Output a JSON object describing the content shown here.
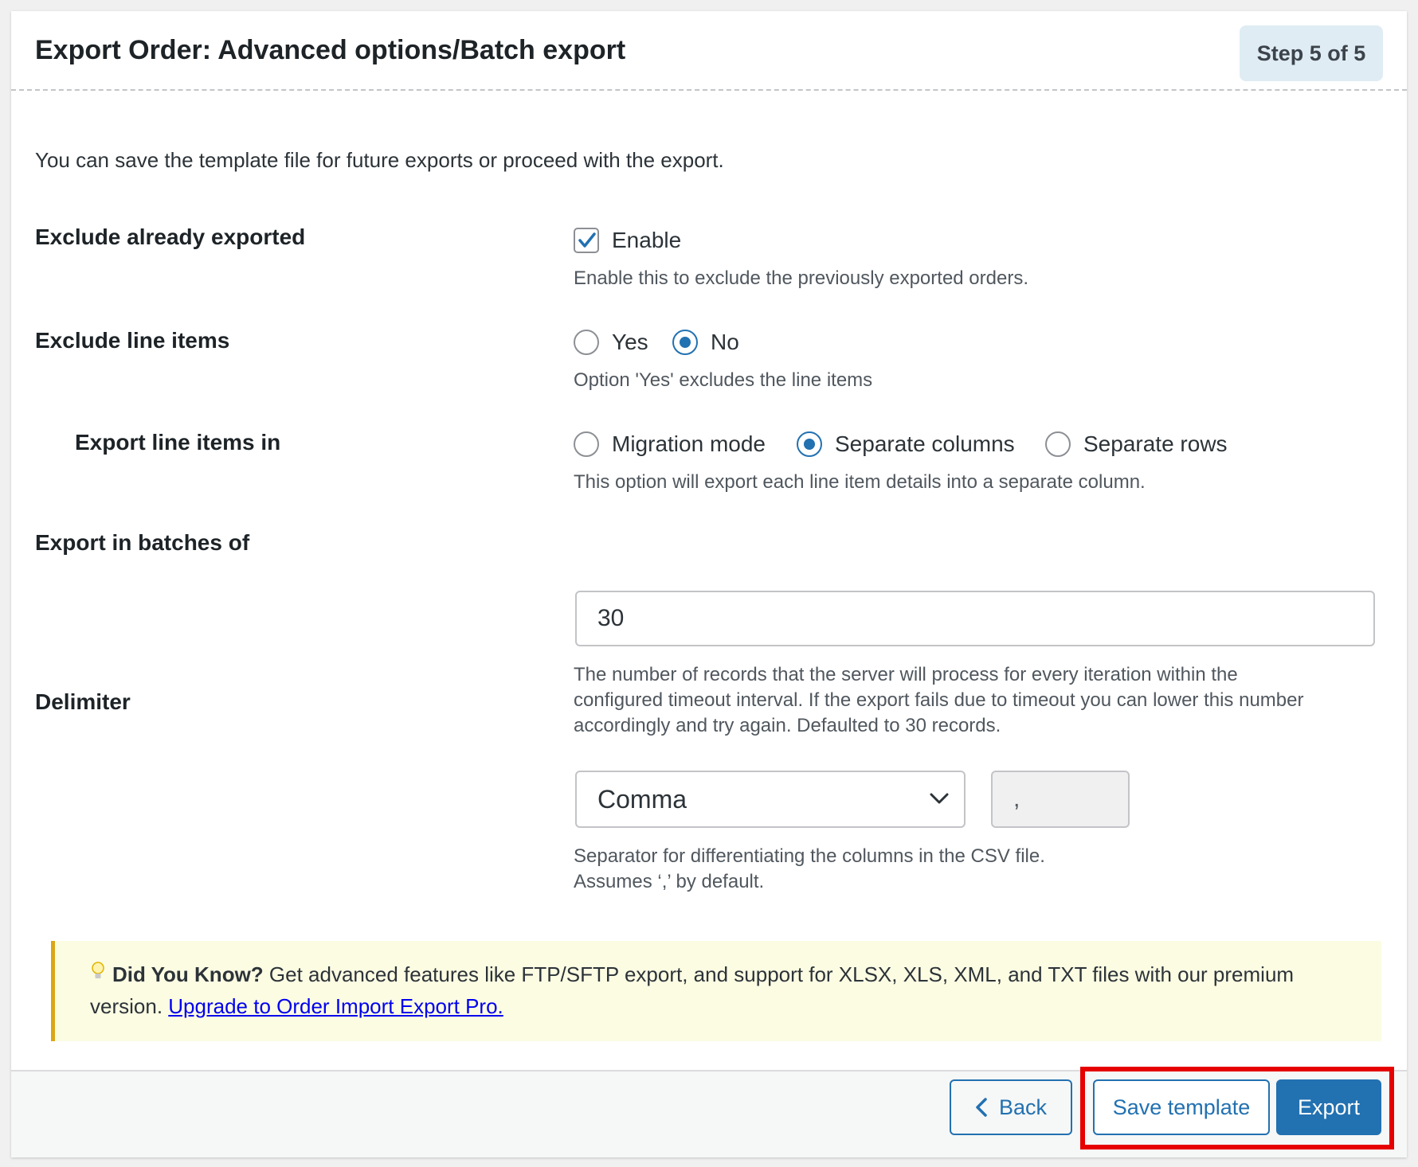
{
  "header": {
    "title": "Export Order: Advanced options/Batch export",
    "step": "Step 5 of 5"
  },
  "intro": "You can save the template file for future exports or proceed with the export.",
  "exclude_exported": {
    "label": "Exclude already exported",
    "checkbox_label": "Enable",
    "checked": true,
    "description": "Enable this to exclude the previously exported orders."
  },
  "exclude_line_items": {
    "label": "Exclude line items",
    "options": [
      "Yes",
      "No"
    ],
    "selected": "No",
    "description": "Option 'Yes' excludes the line items"
  },
  "export_line_items_in": {
    "label": "Export line items in",
    "options": [
      "Migration mode",
      "Separate columns",
      "Separate rows"
    ],
    "selected": "Separate columns",
    "description": "This option will export each line item details into a separate column."
  },
  "batch": {
    "label": "Export in batches of",
    "value": "30",
    "description_lines": [
      "The number of records that the server will process for every iteration within the",
      "configured timeout interval. If the export fails due to timeout you can lower this number",
      "accordingly and try again. Defaulted to 30 records."
    ]
  },
  "delimiter": {
    "label": "Delimiter",
    "selected": "Comma",
    "value": ",",
    "description_lines": [
      "Separator for differentiating the columns in the CSV file.",
      "Assumes ‘,’ by default."
    ]
  },
  "notice": {
    "icon": "lightbulb-icon",
    "heading": "Did You Know?",
    "text": " Get advanced features like FTP/SFTP export, and support for XLSX, XLS, XML, and TXT files with our premium version. ",
    "link": "Upgrade to Order Import Export Pro."
  },
  "footer": {
    "back_label": "Back",
    "save_label": "Save template",
    "export_label": "Export"
  },
  "colors": {
    "accent": "#2271b1",
    "highlight": "#e60000",
    "notice_bg": "#fcfce3",
    "notice_border": "#dba617"
  }
}
